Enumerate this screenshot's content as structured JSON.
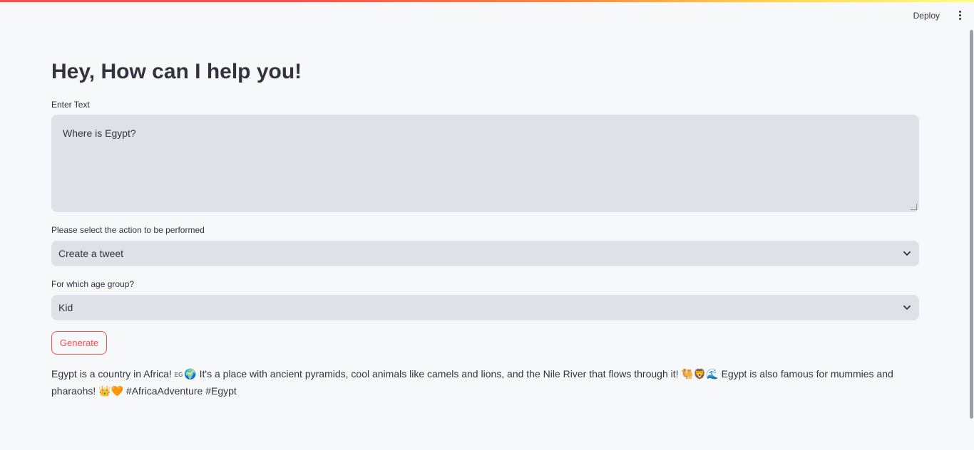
{
  "header": {
    "deploy_label": "Deploy"
  },
  "main": {
    "title": "Hey, How can I help you!",
    "text_input": {
      "label": "Enter Text",
      "value": "Where is Egypt?"
    },
    "action_select": {
      "label": "Please select the action to be performed",
      "value": "Create a tweet"
    },
    "age_select": {
      "label": "For which age group?",
      "value": "Kid"
    },
    "generate_label": "Generate",
    "result": {
      "part1": "Egypt is a country in Africa! ",
      "flag_code": "EG",
      "part2": "🌍 It's a place with ancient pyramids, cool animals like camels and lions, and the Nile River that flows through it! 🐫🦁🌊 Egypt is also famous for mummies and pharaohs! 👑🧡 #AfricaAdventure #Egypt"
    }
  },
  "colors": {
    "accent": "#ff4b4b",
    "input_bg": "#dee2e8",
    "page_bg": "#f7f8fa"
  }
}
